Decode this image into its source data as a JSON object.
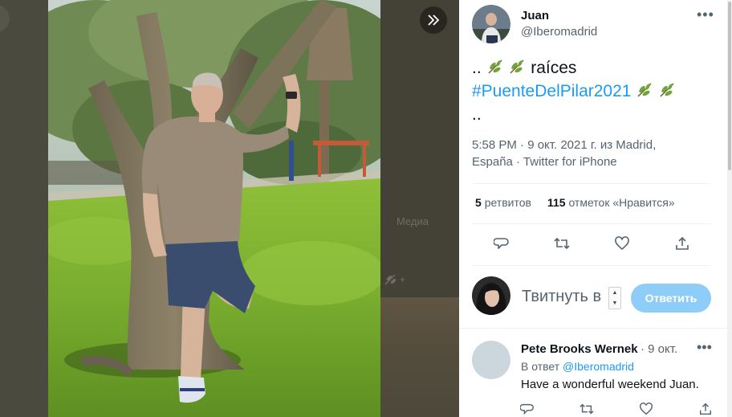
{
  "media_viewer": {
    "background_label": "Медиа",
    "next_icon": "double-chevron-right-icon"
  },
  "tweet": {
    "author_name": "Juan",
    "author_handle": "@Iberomadrid",
    "text_prefix": "..",
    "text_word": "raíces",
    "hashtag": "#PuenteDelPilar2021",
    "text_suffix": "..",
    "emoji": "olive-branch-icon",
    "meta_line1": "5:58 PM · 9 окт. 2021 г. из Madrid,",
    "meta_line2": "España · Twitter for iPhone",
    "retweets_count": "5",
    "retweets_label": "ретвитов",
    "likes_count": "115",
    "likes_label": "отметок «Нравится»"
  },
  "actions": [
    "reply-icon",
    "retweet-icon",
    "like-icon",
    "share-icon"
  ],
  "compose": {
    "placeholder": "Твитнуть в",
    "reply_button": "Ответить"
  },
  "reply": {
    "author_name": "Pete Brooks Wernek",
    "date": "· 9 окт.",
    "replying_to_prefix": "В ответ",
    "replying_to_handle": "@Iberomadrid",
    "text": "Have a wonderful weekend Juan."
  },
  "colors": {
    "accent": "#1d9bf0",
    "reply_button": "#8ecdf8",
    "secondary_text": "#536471"
  }
}
